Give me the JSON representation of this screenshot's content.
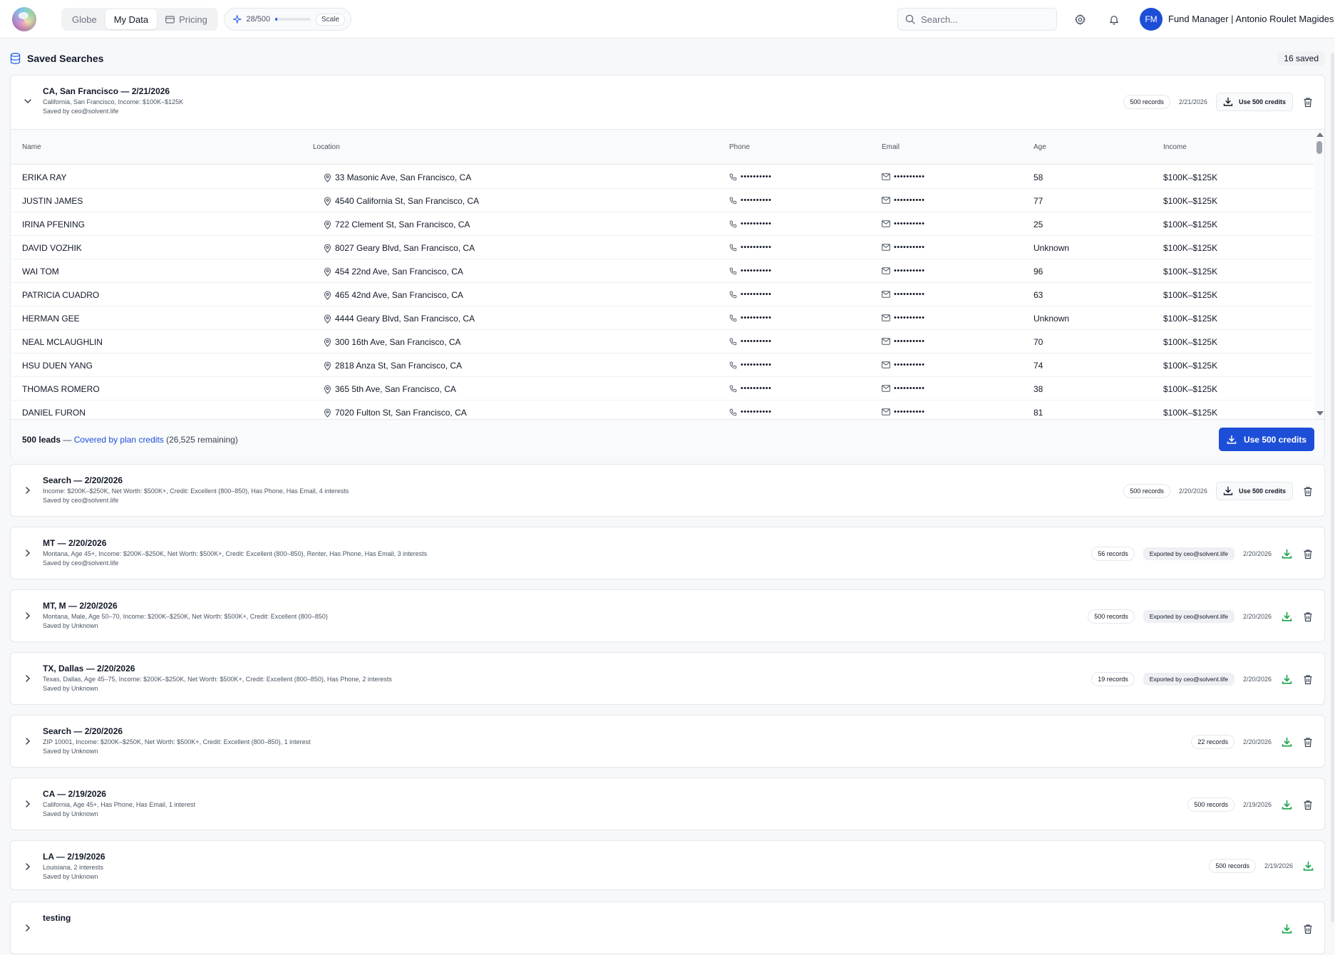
{
  "nav": {
    "logo_icon": "app-logo-orb",
    "tabs": [
      {
        "label": "Globe",
        "icon": "",
        "active": false
      },
      {
        "label": "My Data",
        "icon": "",
        "active": true
      },
      {
        "label": "Pricing",
        "icon": "card-icon",
        "active": false
      }
    ]
  },
  "credits": {
    "label": "28/500",
    "used": 28,
    "total": 500,
    "plan": "Scale",
    "icon": "sparkle-icon"
  },
  "search": {
    "placeholder": "Search..."
  },
  "user": {
    "initials": "FM",
    "name": "Fund Manager | Antonio Roulet Magides"
  },
  "page": {
    "title": "Saved Searches",
    "saved_count": "16 saved",
    "title_icon": "database-icon"
  },
  "colors": {
    "accent": "#1d4ed8",
    "success": "#16a34a"
  },
  "expanded": {
    "title": "CA, San Francisco — 2/21/2026",
    "subtitle": "California, San Francisco, Income: $100K–$125K",
    "saved_by": "Saved by ceo@solvent.life",
    "records": "500 records",
    "date": "2/21/2026",
    "use_label": "Use 500 credits",
    "columns": [
      "Name",
      "Location",
      "Phone",
      "Email",
      "Age",
      "Income"
    ],
    "rows": [
      {
        "name": "ERIKA RAY",
        "location": "33 Masonic Ave, San Francisco, CA",
        "phone": "••••••••••",
        "email": "••••••••••",
        "age": "58",
        "income": "$100K–$125K"
      },
      {
        "name": "JUSTIN JAMES",
        "location": "4540 California St, San Francisco, CA",
        "phone": "••••••••••",
        "email": "••••••••••",
        "age": "77",
        "income": "$100K–$125K"
      },
      {
        "name": "IRINA PFENING",
        "location": "722 Clement St, San Francisco, CA",
        "phone": "••••••••••",
        "email": "••••••••••",
        "age": "25",
        "income": "$100K–$125K"
      },
      {
        "name": "DAVID VOZHIK",
        "location": "8027 Geary Blvd, San Francisco, CA",
        "phone": "••••••••••",
        "email": "••••••••••",
        "age": "Unknown",
        "income": "$100K–$125K"
      },
      {
        "name": "WAI TOM",
        "location": "454 22nd Ave, San Francisco, CA",
        "phone": "••••••••••",
        "email": "••••••••••",
        "age": "96",
        "income": "$100K–$125K"
      },
      {
        "name": "PATRICIA CUADRO",
        "location": "465 42nd Ave, San Francisco, CA",
        "phone": "••••••••••",
        "email": "••••••••••",
        "age": "63",
        "income": "$100K–$125K"
      },
      {
        "name": "HERMAN GEE",
        "location": "4444 Geary Blvd, San Francisco, CA",
        "phone": "••••••••••",
        "email": "••••••••••",
        "age": "Unknown",
        "income": "$100K–$125K"
      },
      {
        "name": "NEAL MCLAUGHLIN",
        "location": "300 16th Ave, San Francisco, CA",
        "phone": "••••••••••",
        "email": "••••••••••",
        "age": "70",
        "income": "$100K–$125K"
      },
      {
        "name": "HSU DUEN YANG",
        "location": "2818 Anza St, San Francisco, CA",
        "phone": "••••••••••",
        "email": "••••••••••",
        "age": "74",
        "income": "$100K–$125K"
      },
      {
        "name": "THOMAS ROMERO",
        "location": "365 5th Ave, San Francisco, CA",
        "phone": "••••••••••",
        "email": "••••••••••",
        "age": "38",
        "income": "$100K–$125K"
      },
      {
        "name": "DANIEL FURON",
        "location": "7020 Fulton St, San Francisco, CA",
        "phone": "••••••••••",
        "email": "••••••••••",
        "age": "81",
        "income": "$100K–$125K"
      }
    ],
    "footer": {
      "leads": "500 leads",
      "sep": " — ",
      "covered": "Covered by plan credits",
      "remaining": " (26,525 remaining)",
      "button": "Use 500 credits"
    }
  },
  "searches": [
    {
      "title": "Search — 2/20/2026",
      "subtitle": "Income: $200K–$250K, Net Worth: $500K+, Credit: Excellent (800–850), Has Phone, Has Email, 4 interests",
      "saved_by": "Saved by ceo@solvent.life",
      "records": "500 records",
      "exported": "",
      "date": "2/20/2026",
      "action": "Use 500 credits"
    },
    {
      "title": "MT — 2/20/2026",
      "subtitle": "Montana, Age 45+, Income: $200K–$250K, Net Worth: $500K+, Credit: Excellent (800–850), Renter, Has Phone, Has Email, 3 interests",
      "saved_by": "Saved by ceo@solvent.life",
      "records": "56 records",
      "exported": "Exported by ceo@solvent.life",
      "date": "2/20/2026",
      "action": ""
    },
    {
      "title": "MT, M — 2/20/2026",
      "subtitle": "Montana, Male, Age 50–70, Income: $200K–$250K, Net Worth: $500K+, Credit: Excellent (800–850)",
      "saved_by": "Saved by Unknown",
      "records": "500 records",
      "exported": "Exported by ceo@solvent.life",
      "date": "2/20/2026",
      "action": ""
    },
    {
      "title": "TX, Dallas — 2/20/2026",
      "subtitle": "Texas, Dallas, Age 45–75, Income: $200K–$250K, Net Worth: $500K+, Credit: Excellent (800–850), Has Phone, 2 interests",
      "saved_by": "Saved by Unknown",
      "records": "19 records",
      "exported": "Exported by ceo@solvent.life",
      "date": "2/20/2026",
      "action": ""
    },
    {
      "title": "Search — 2/20/2026",
      "subtitle": "ZIP 10001, Income: $200K–$250K, Net Worth: $500K+, Credit: Excellent (800–850), 1 interest",
      "saved_by": "Saved by Unknown",
      "records": "22 records",
      "exported": "",
      "date": "2/20/2026",
      "action": ""
    },
    {
      "title": "CA — 2/19/2026",
      "subtitle": "California, Age 45+, Has Phone, Has Email, 1 interest",
      "saved_by": "Saved by Unknown",
      "records": "500 records",
      "exported": "",
      "date": "2/19/2026",
      "action": ""
    },
    {
      "title": "LA — 2/19/2026",
      "subtitle": "Louisiana, 2 interests",
      "saved_by": "Saved by Unknown",
      "records": "500 records",
      "exported": "",
      "date": "2/19/2026",
      "action": "",
      "no_delete": true
    },
    {
      "title": "testing",
      "subtitle": "",
      "saved_by": "",
      "records": "",
      "exported": "",
      "date": "",
      "action": ""
    }
  ]
}
